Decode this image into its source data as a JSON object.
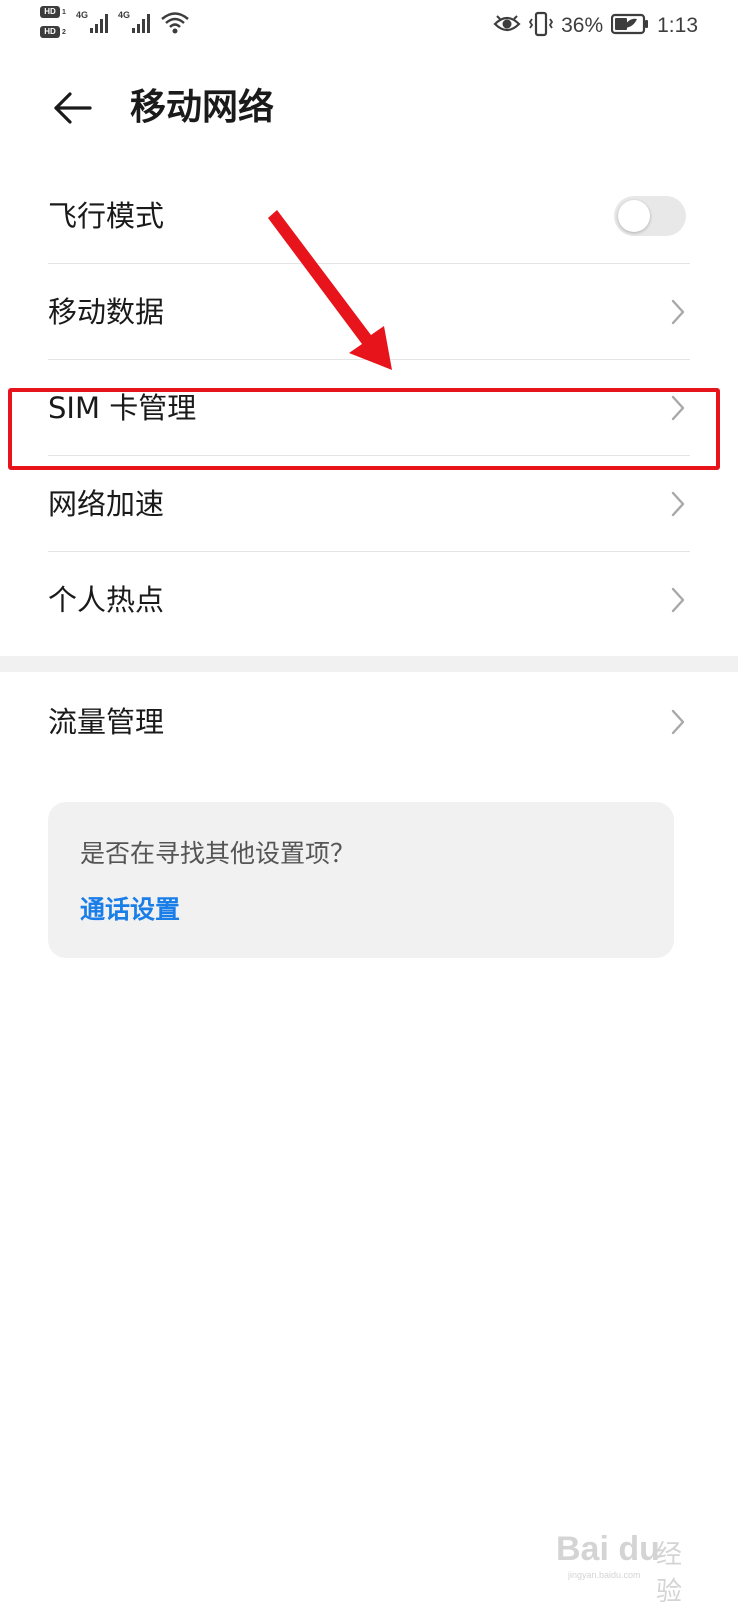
{
  "status_bar": {
    "hd1": "HD",
    "hd1_num": "1",
    "hd2": "HD",
    "hd2_num": "2",
    "net1": "4G",
    "net2": "4G",
    "battery_percent": "36%",
    "time": "1:13",
    "icons": [
      "eye-icon",
      "vibrate-icon",
      "battery-icon",
      "wifi-icon",
      "signal-icon"
    ]
  },
  "header": {
    "title": "移动网络",
    "back_icon": "back-arrow-icon"
  },
  "list": {
    "items": [
      {
        "label": "飞行模式",
        "control": "toggle",
        "toggle_on": false
      },
      {
        "label": "移动数据",
        "control": "chevron"
      },
      {
        "label": "SIM 卡管理",
        "control": "chevron",
        "highlighted": true
      },
      {
        "label": "网络加速",
        "control": "chevron"
      },
      {
        "label": "个人热点",
        "control": "chevron"
      }
    ],
    "standalone": {
      "label": "流量管理",
      "control": "chevron"
    }
  },
  "hint": {
    "question": "是否在寻找其他设置项？",
    "link": "通话设置"
  },
  "annotation": {
    "box_color": "#e8141b",
    "arrow_color": "#e8141b"
  },
  "watermark": {
    "brand": "Bai du",
    "cn": "经验",
    "url": "jingyan.baidu.com"
  },
  "colors": {
    "accent": "#1a7ee8",
    "background": "#ffffff",
    "divider": "#e4e4e4",
    "card": "#f1f1f1"
  }
}
